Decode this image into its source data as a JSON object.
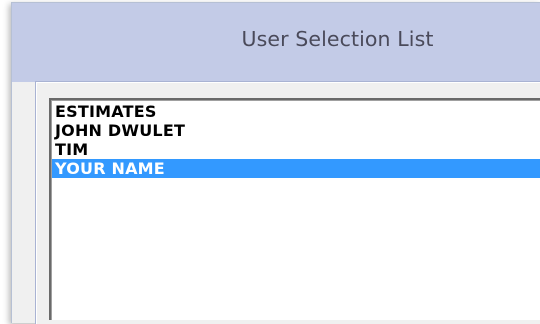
{
  "window": {
    "title": "User Selection List"
  },
  "user_list": {
    "items": [
      {
        "label": "ESTIMATES",
        "selected": false
      },
      {
        "label": "JOHN DWULET",
        "selected": false
      },
      {
        "label": "TIM",
        "selected": false
      },
      {
        "label": "YOUR NAME",
        "selected": true
      }
    ]
  },
  "colors": {
    "titlebar": "#c3cbe7",
    "selection": "#3399ff",
    "dialog_background": "#f0f0f0",
    "list_background": "#ffffff"
  }
}
